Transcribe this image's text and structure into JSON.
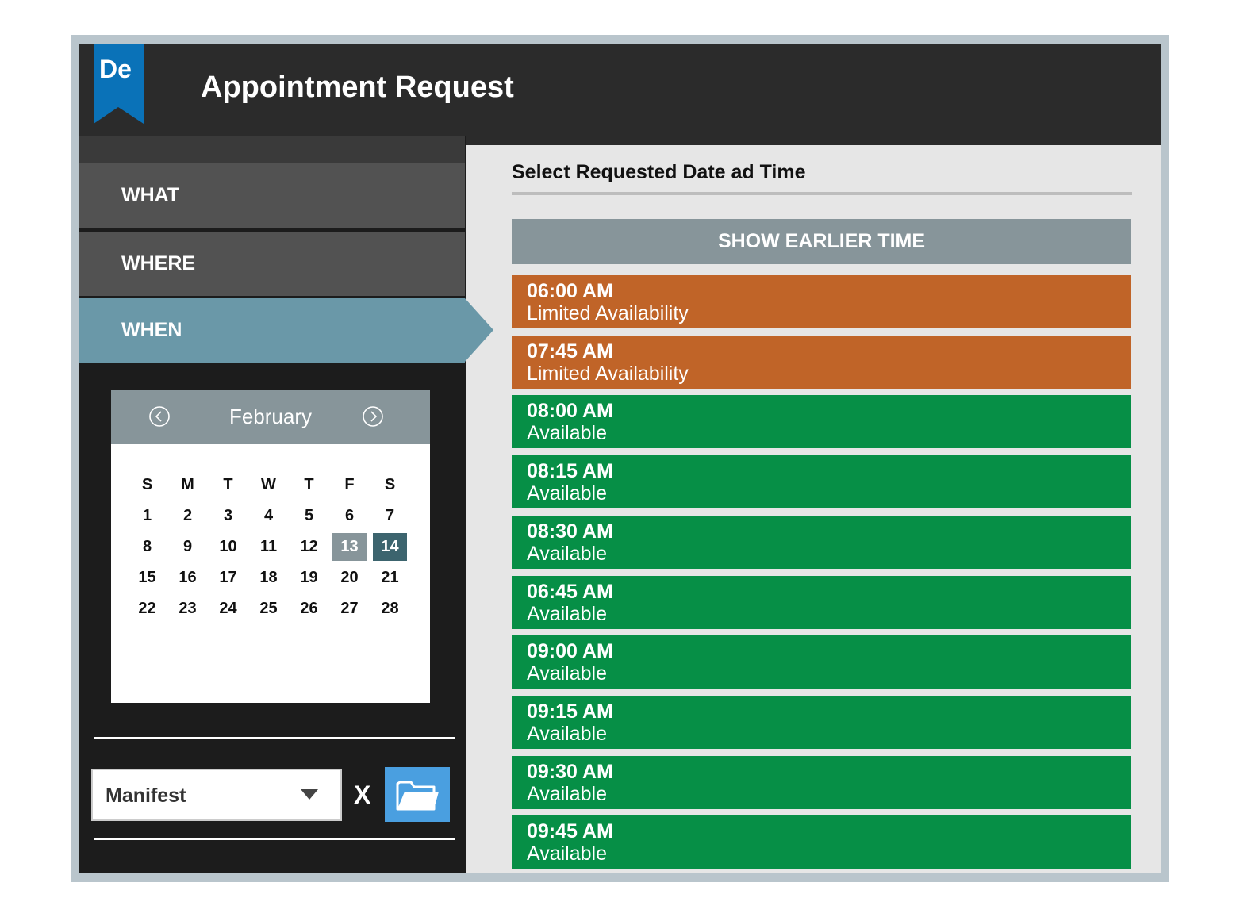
{
  "app": {
    "logo_text": "De",
    "title": "Appointment Request"
  },
  "sidebar": {
    "items": [
      {
        "label": "WHAT",
        "active": false
      },
      {
        "label": "WHERE",
        "active": false
      },
      {
        "label": "WHEN",
        "active": true
      }
    ]
  },
  "calendar": {
    "month": "February",
    "weekdays": [
      "S",
      "M",
      "T",
      "W",
      "T",
      "F",
      "S"
    ],
    "weeks": [
      [
        "1",
        "2",
        "3",
        "4",
        "5",
        "6",
        "7"
      ],
      [
        "8",
        "9",
        "10",
        "11",
        "12",
        "13",
        "14"
      ],
      [
        "15",
        "16",
        "17",
        "18",
        "19",
        "20",
        "21"
      ],
      [
        "22",
        "23",
        "24",
        "25",
        "26",
        "27",
        "28"
      ]
    ],
    "highlighted_day": "13",
    "selected_day": "14",
    "colors": {
      "highlight": "#87959a",
      "selected": "#3c646e"
    }
  },
  "document": {
    "dropdown_value": "Manifest",
    "clear_label": "X"
  },
  "main": {
    "title": "Select Requested Date ad Time",
    "earlier_button": "SHOW EARLIER TIME",
    "slots": [
      {
        "time": "06:00 AM",
        "status": "Limited Availability",
        "kind": "limited"
      },
      {
        "time": "07:45 AM",
        "status": "Limited Availability",
        "kind": "limited"
      },
      {
        "time": "08:00 AM",
        "status": "Available",
        "kind": "available"
      },
      {
        "time": "08:15 AM",
        "status": "Available",
        "kind": "available"
      },
      {
        "time": "08:30 AM",
        "status": "Available",
        "kind": "available"
      },
      {
        "time": "06:45 AM",
        "status": "Available",
        "kind": "available"
      },
      {
        "time": "09:00 AM",
        "status": "Available",
        "kind": "available"
      },
      {
        "time": "09:15 AM",
        "status": "Available",
        "kind": "available"
      },
      {
        "time": "09:30 AM",
        "status": "Available",
        "kind": "available"
      },
      {
        "time": "09:45 AM",
        "status": "Available",
        "kind": "available"
      }
    ],
    "colors": {
      "limited": "#c06428",
      "available": "#068f46"
    }
  },
  "icons": {
    "logo": "bookmark-icon",
    "prev": "chevron-left-circle-icon",
    "next": "chevron-right-circle-icon",
    "dropdown": "caret-down-icon",
    "folder": "folder-icon"
  }
}
